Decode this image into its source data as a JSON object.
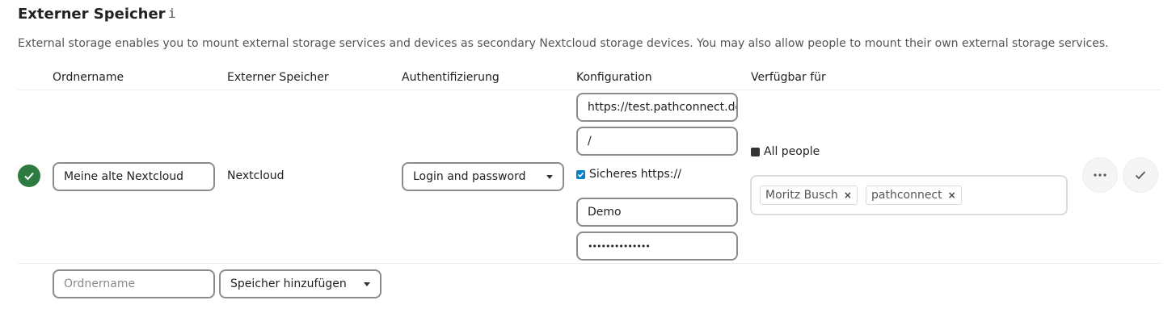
{
  "section": {
    "title": "Externer Speicher",
    "info_icon": "i",
    "description": "External storage enables you to mount external storage services and devices as secondary Nextcloud storage devices. You may also allow people to mount their own external storage services."
  },
  "table": {
    "headers": {
      "folder": "Ordnername",
      "storage": "Externer Speicher",
      "auth": "Authentifizierung",
      "config": "Konfiguration",
      "available": "Verfügbar für"
    },
    "mount": {
      "status_icon": "check-circle-icon",
      "status_color": "#2d7b41",
      "folder_name": "Meine alte Nextcloud",
      "backend": "Nextcloud",
      "auth_method": "Login and password",
      "config": {
        "url": "https://test.pathconnect.de",
        "remote_subfolder": "/",
        "secure_label": "Sicheres https://",
        "secure_checked": true,
        "user": "Demo",
        "password": "••••••••••••••"
      },
      "all_people_label": "All people",
      "all_people_checked": false,
      "applicable": [
        "Moritz Busch",
        "pathconnect"
      ],
      "remove_tag_symbol": "×",
      "actions": {
        "more_icon": "dots-horizontal-icon",
        "save_icon": "check-icon"
      }
    },
    "new_row": {
      "folder_placeholder": "Ordnername",
      "add_storage_label": "Speicher hinzufügen"
    }
  },
  "colors": {
    "accent": "#0082c9",
    "success": "#2d7b41",
    "border": "#8c8c8c"
  }
}
